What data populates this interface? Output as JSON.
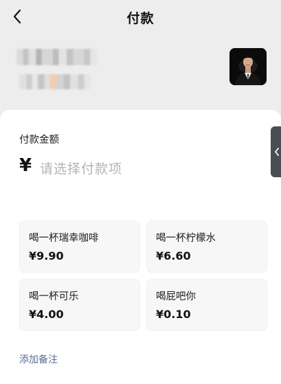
{
  "header": {
    "title": "付款"
  },
  "payee": {
    "name_blurred": true,
    "avatar": "person-in-suit-photo"
  },
  "payment": {
    "amount_label": "付款金额",
    "currency_symbol": "¥",
    "amount_placeholder": "请选择付款项"
  },
  "items": [
    {
      "name": "喝一杯瑞幸咖啡",
      "price": "¥9.90"
    },
    {
      "name": "喝一杯柠檬水",
      "price": "¥6.60"
    },
    {
      "name": "喝一杯可乐",
      "price": "¥4.00"
    },
    {
      "name": "喝屁吧你",
      "price": "¥0.10"
    }
  ],
  "footer": {
    "add_note_label": "添加备注"
  },
  "colors": {
    "page_bg": "#ededed",
    "card_bg": "#ffffff",
    "item_bg": "#f7f7f7",
    "link": "#576b95",
    "placeholder": "#b3b3b3",
    "side_handle": "#4a4d52"
  },
  "icons": {
    "back": "chevron-left-icon",
    "side_handle": "chevron-left-icon"
  }
}
